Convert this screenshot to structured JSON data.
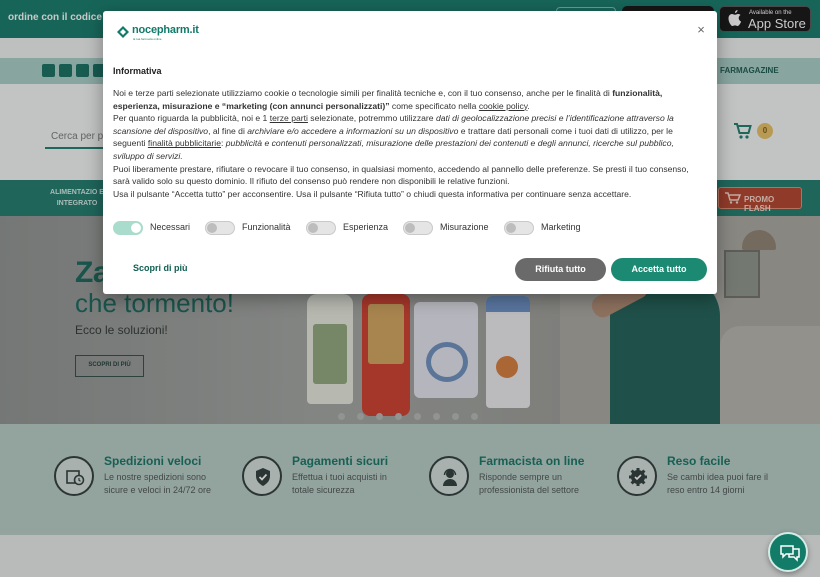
{
  "topbar": {
    "promo_text": "ordine con il codice -",
    "appstore_small": "Available on the",
    "appstore_big": "App Store"
  },
  "nav": {
    "farmagazine": "FARMAGAZINE"
  },
  "header": {
    "search_placeholder": "Cerca per p",
    "cart_count": "0"
  },
  "categories": {
    "first_label": "ALIMENTAZIO E INTEGRATO",
    "promo_flash": "PROMO FLASH"
  },
  "hero": {
    "title_line1": "Za",
    "title_line2": "che tormento!",
    "subtitle": "Ecco le soluzioni!",
    "cta": "SCOPRI DI PIÙ"
  },
  "features": [
    {
      "title": "Spedizioni veloci",
      "text": "Le nostre spedizioni sono sicure e veloci in 24/72 ore",
      "icon": "clock-box-icon"
    },
    {
      "title": "Pagamenti sicuri",
      "text": "Effettua i tuoi acquisti in totale sicurezza",
      "icon": "shield-check-icon"
    },
    {
      "title": "Farmacista on line",
      "text": "Risponde sempre un professionista del settore",
      "icon": "headset-person-icon"
    },
    {
      "title": "Reso facile",
      "text": "Se cambi idea puoi fare il reso entro 14 giorni",
      "icon": "gear-check-icon"
    }
  ],
  "modal": {
    "logo": "nocepharm.it",
    "logo_tag": "la tua farmacia online",
    "title": "Informativa",
    "close": "×",
    "p1_a": "Noi e terze parti selezionate utilizziamo cookie o tecnologie simili per finalità tecniche e, con il tuo consenso, anche per le finalità di ",
    "p1_b": "funzionalità, esperienza, misurazione e “marketing (con annunci personalizzati)”",
    "p1_c": " come specificato nella ",
    "p1_link": "cookie policy",
    "p1_d": ".",
    "p2_a": "Per quanto riguarda la pubblicità, noi e 1 ",
    "p2_link1": "terze parti",
    "p2_b": " selezionate, potremmo utilizzare ",
    "p2_i1": "dati di geolocalizzazione precisi e l’identificazione attraverso la scansione del dispositivo",
    "p2_c": ", al fine di ",
    "p2_i2": "archiviare e/o accedere a informazioni su un dispositivo",
    "p2_d": " e trattare dati personali come i tuoi dati di utilizzo, per le seguenti ",
    "p2_link2": "finalità pubblicitarie",
    "p2_e": ": ",
    "p2_i3": "pubblicità e contenuti personalizzati, misurazione delle prestazioni dei contenuti e degli annunci, ricerche sul pubblico, sviluppo di servizi.",
    "p3": "Puoi liberamente prestare, rifiutare o revocare il tuo consenso, in qualsiasi momento, accedendo al pannello delle preferenze. Se presti il tuo consenso, sarà valido solo su questo dominio. Il rifiuto del consenso può rendere non disponibili le relative funzioni.",
    "p4": "Usa il pulsante “Accetta tutto” per acconsentire. Usa il pulsante “Rifiuta tutto” o chiudi questa informativa per continuare senza accettare.",
    "toggles": [
      {
        "label": "Necessari",
        "on": true
      },
      {
        "label": "Funzionalità",
        "on": false
      },
      {
        "label": "Esperienza",
        "on": false
      },
      {
        "label": "Misurazione",
        "on": false
      },
      {
        "label": "Marketing",
        "on": false
      }
    ],
    "learn_more": "Scopri di più",
    "reject_all": "Rifiuta tutto",
    "accept_all": "Accetta tutto"
  },
  "colors": {
    "brand": "#127a6a",
    "accept": "#1c8a73",
    "reject": "#6a6a6a",
    "promo_flash": "#b3402a"
  }
}
